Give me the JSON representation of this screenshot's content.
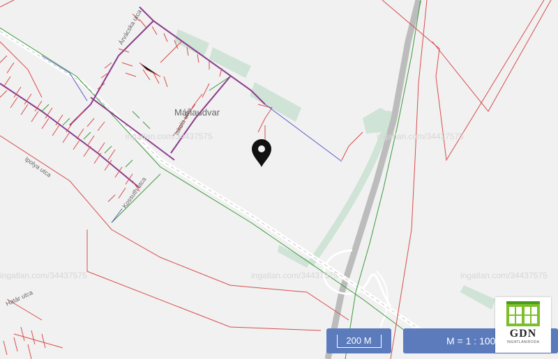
{
  "map": {
    "place_label": "Máriaudvar",
    "street_labels": [
      "Árvácska utca",
      "Iskola utca",
      "Ipolya utca",
      "Kossuth utca",
      "Határ utca"
    ],
    "watermark_text": "ingatlan.com/34437575",
    "marker_icon": "map-pin-icon",
    "colors": {
      "background": "#f1f1f1",
      "power_line": "#d94a4a",
      "pipeline_green": "#3a9a3a",
      "pipeline_purple": "#8a3c8a",
      "pipeline_blue": "#5a5ac8",
      "railway": "#b8b8b8",
      "vegetation": "#cfe3d6",
      "control_bar": "#5b7bbd"
    }
  },
  "controls": {
    "scale_bar_label": "200 M",
    "ratio_label": "M = 1 : 100"
  },
  "logo": {
    "text": "GDN",
    "subtext": "INGATLANIRODA"
  }
}
